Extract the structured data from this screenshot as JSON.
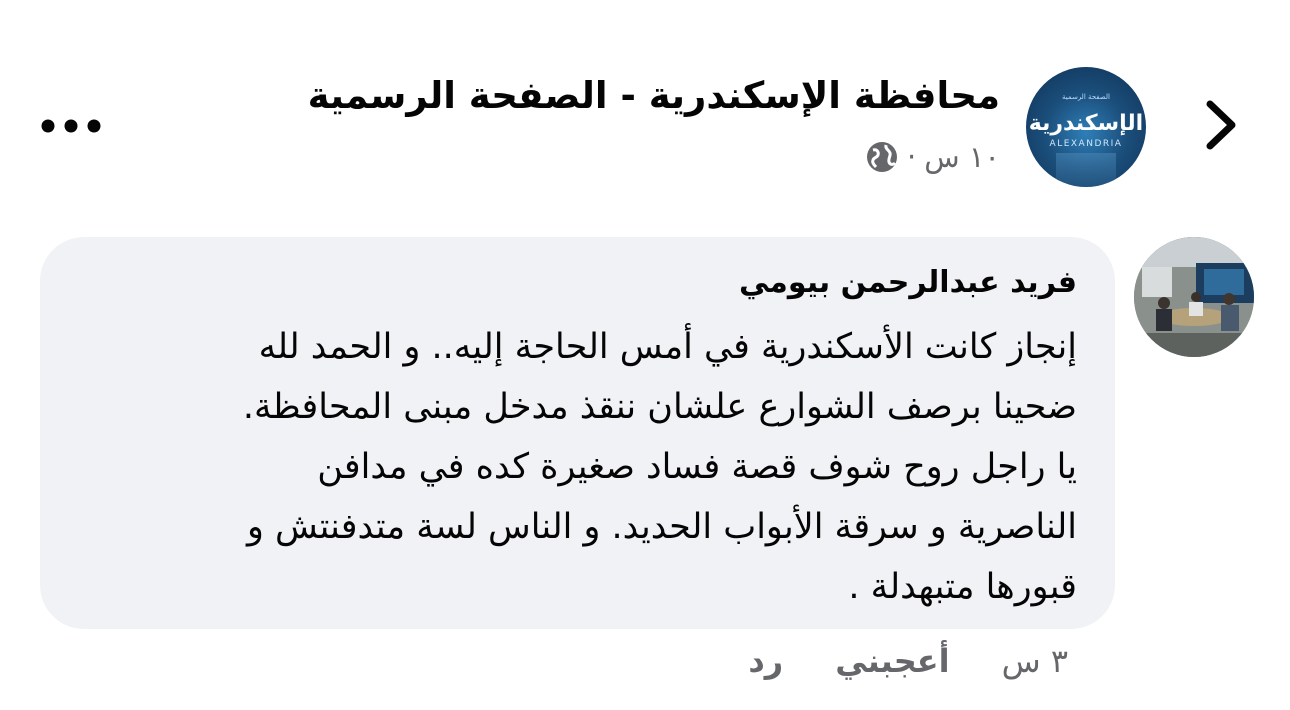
{
  "post_header": {
    "page_name": "محافظة الإسكندرية - الصفحة الرسمية",
    "time": "١٠ س",
    "separator": "·",
    "avatar_logo_text": "الإسكندرية",
    "avatar_logo_sub": "ALEXANDRIA",
    "avatar_logo_top": "الصفحة الرسمية"
  },
  "comment": {
    "author": "فريد عبدالرحمن بيومي",
    "lines": [
      "إنجاز كانت الأسكندرية في أمس الحاجة إليه.. و الحمد لله",
      "ضحينا برصف الشوارع علشان ننقذ مدخل مبنى المحافظة.",
      "يا راجل روح شوف قصة فساد صغيرة كده في مدافن",
      "الناصرية و سرقة الأبواب الحديد.  و الناس لسة متدفنتش و",
      "قبورها متبهدلة ."
    ],
    "time": "٣ س",
    "like_label": "أعجبني",
    "reply_label": "رد"
  },
  "icons": {
    "back": "chevron-right-icon",
    "more": "more-dots-icon",
    "audience": "globe-icon"
  },
  "colors": {
    "text_primary": "#050505",
    "text_secondary": "#65676b",
    "bubble_bg": "#f0f2f5"
  }
}
